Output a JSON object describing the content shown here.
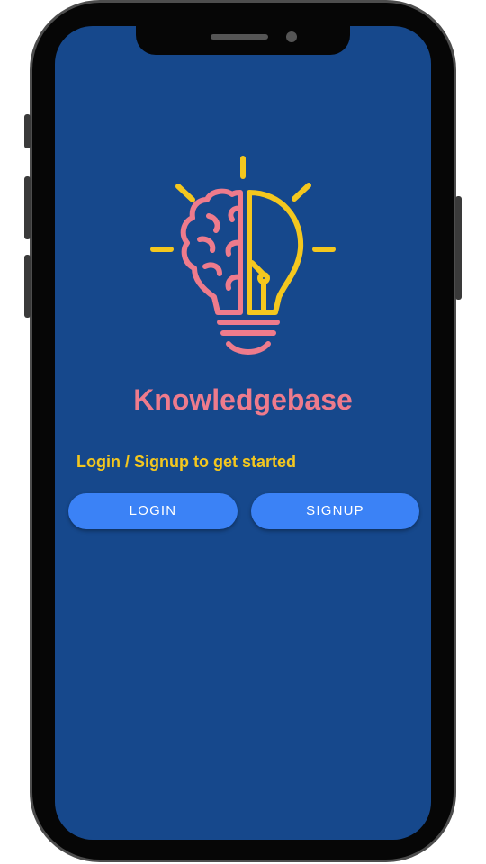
{
  "app": {
    "title": "Knowledgebase",
    "subtitle": "Login / Signup to get started"
  },
  "buttons": {
    "login_label": "LOGIN",
    "signup_label": "SIGNUP"
  },
  "colors": {
    "background": "#16488c",
    "title": "#ee7b8c",
    "subtitle": "#f4c71e",
    "button": "#3b82f6"
  },
  "icons": {
    "logo": "brain-lightbulb-icon"
  }
}
